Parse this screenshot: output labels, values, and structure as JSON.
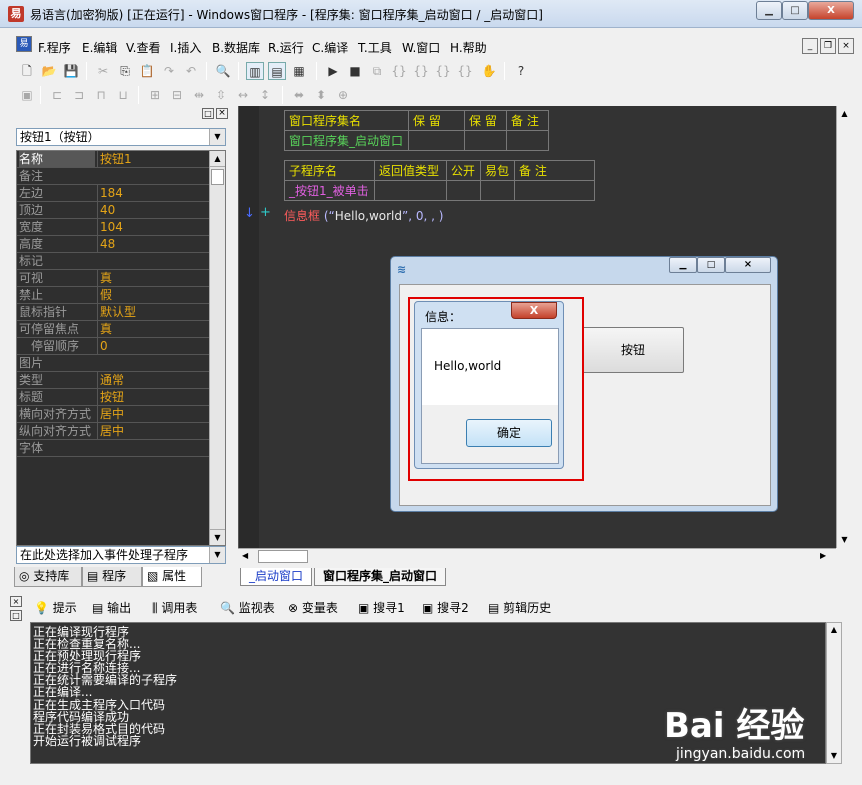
{
  "window": {
    "title": "易语言(加密狗版) [正在运行] - Windows窗口程序 - [程序集: 窗口程序集_启动窗口 / _启动窗口]",
    "minimize": "▁",
    "maximize": "□",
    "close": "X"
  },
  "menu": [
    "F.程序",
    "E.编辑",
    "V.查看",
    "I.插入",
    "B.数据库",
    "R.运行",
    "C.编译",
    "T.工具",
    "W.窗口",
    "H.帮助"
  ],
  "mdi_controls": [
    "_",
    "❐",
    "×"
  ],
  "left_panel": {
    "component_combo": "按钮1（按钮）",
    "properties": [
      {
        "name": "名称",
        "value": "按钮1"
      },
      {
        "name": "备注",
        "value": ""
      },
      {
        "name": "左边",
        "value": "184"
      },
      {
        "name": "顶边",
        "value": "40"
      },
      {
        "name": "宽度",
        "value": "104"
      },
      {
        "name": "高度",
        "value": "48"
      },
      {
        "name": "标记",
        "value": ""
      },
      {
        "name": "可视",
        "value": "真"
      },
      {
        "name": "禁止",
        "value": "假"
      },
      {
        "name": "鼠标指针",
        "value": "默认型"
      },
      {
        "name": "可停留焦点",
        "value": "真"
      },
      {
        "name": "停留顺序",
        "value": "0"
      },
      {
        "name": "图片",
        "value": ""
      },
      {
        "name": "类型",
        "value": "通常"
      },
      {
        "name": "标题",
        "value": "按钮"
      },
      {
        "name": "横向对齐方式",
        "value": "居中"
      },
      {
        "name": "纵向对齐方式",
        "value": "居中"
      },
      {
        "name": "字体",
        "value": ""
      }
    ],
    "event_combo": "在此处选择加入事件处理子程序",
    "tabs": [
      "支持库",
      "程序",
      "属性"
    ]
  },
  "editor": {
    "assembly_table": {
      "headers": [
        "窗口程序集名",
        "保 留",
        "保 留",
        "备 注"
      ],
      "row": [
        "窗口程序集_启动窗口",
        "",
        "",
        ""
      ]
    },
    "sub_table": {
      "headers": [
        "子程序名",
        "返回值类型",
        "公开",
        "易包",
        "备 注"
      ],
      "row": [
        "_按钮1_被单击",
        "",
        "",
        "",
        ""
      ]
    },
    "code_fn": "信息框",
    "code_args_open": " (“",
    "code_str": "Hello,world",
    "code_args_close": "”, 0, , )",
    "tabs": [
      "_启动窗口",
      "窗口程序集_启动窗口"
    ]
  },
  "running_window": {
    "button_label": "按钮",
    "msgbox": {
      "title": "信息：",
      "close": "X",
      "message": "Hello,world",
      "ok": "确定"
    }
  },
  "bottom_tabs": [
    "提示",
    "输出",
    "调用表",
    "监视表",
    "变量表",
    "搜寻1",
    "搜寻2",
    "剪辑历史"
  ],
  "output_lines": [
    "正在编译现行程序",
    "正在检查重复名称...",
    "正在预处理现行程序",
    "正在进行名称连接...",
    "正在统计需要编译的子程序",
    "正在编译...",
    "正在生成主程序入口代码",
    "程序代码编译成功",
    "正在封装易格式目的代码",
    "开始运行被调试程序"
  ],
  "watermark": {
    "logo": "Bai 经验",
    "url": "jingyan.baidu.com"
  }
}
